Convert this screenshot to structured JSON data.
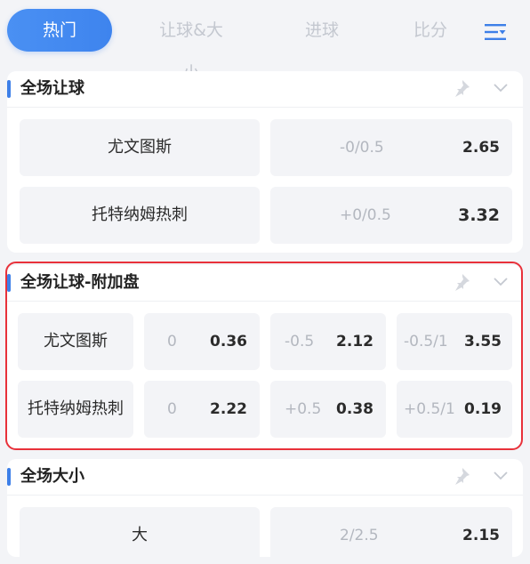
{
  "tabs": [
    {
      "label": "热门",
      "active": true
    },
    {
      "label": "让球&大小",
      "active": false
    },
    {
      "label": "进球",
      "active": false
    },
    {
      "label": "比分",
      "active": false
    }
  ],
  "accent_color": "#3d7fe8",
  "highlight_color": "#e8313a",
  "sections": {
    "handicap": {
      "title": "全场让球",
      "rows": [
        {
          "team": "尤文图斯",
          "line": "-0/0.5",
          "odds": "2.65"
        },
        {
          "team": "托特纳姆热刺",
          "line": "+0/0.5",
          "odds": "3.32"
        }
      ]
    },
    "handicap_extra": {
      "title": "全场让球-附加盘",
      "rows": [
        {
          "team": "尤文图斯",
          "options": [
            {
              "line": "0",
              "odds": "0.36"
            },
            {
              "line": "-0.5",
              "odds": "2.12"
            },
            {
              "line": "-0.5/1",
              "odds": "3.55"
            }
          ]
        },
        {
          "team": "托特纳姆热刺",
          "options": [
            {
              "line": "0",
              "odds": "2.22"
            },
            {
              "line": "+0.5",
              "odds": "0.38"
            },
            {
              "line": "+0.5/1",
              "odds": "0.19"
            }
          ]
        }
      ]
    },
    "totals": {
      "title": "全场大小",
      "rows": [
        {
          "team": "大",
          "line": "2/2.5",
          "odds": "2.15"
        }
      ]
    }
  },
  "icons": {
    "menu": "filter-menu-icon",
    "pin": "pin-icon",
    "collapse": "chevron-down-icon"
  }
}
